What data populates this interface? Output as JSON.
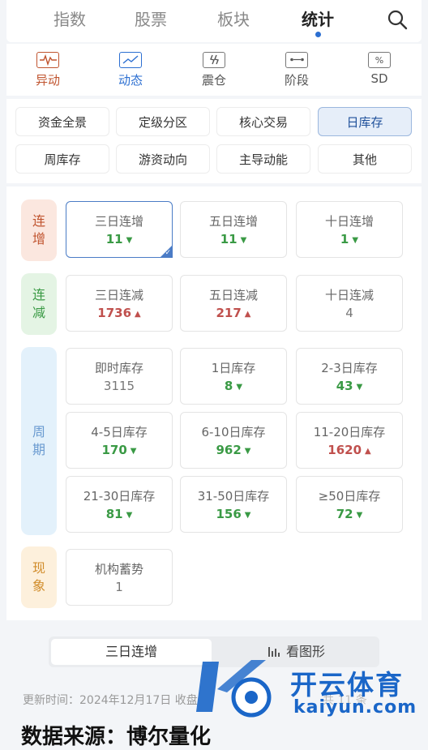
{
  "top_tabs": [
    "指数",
    "股票",
    "板块",
    "统计"
  ],
  "sub_nav": [
    {
      "label": "异动",
      "icon": "pulse-icon"
    },
    {
      "label": "动态",
      "icon": "trend-icon"
    },
    {
      "label": "震仓",
      "icon": "shake-icon"
    },
    {
      "label": "阶段",
      "icon": "stage-icon"
    },
    {
      "label": "SD",
      "icon": "percent-icon"
    }
  ],
  "categories": [
    "资金全景",
    "定级分区",
    "核心交易",
    "日库存",
    "周库存",
    "游资动向",
    "主导动能",
    "其他"
  ],
  "groups": {
    "lianzeng": {
      "label_1": "连",
      "label_2": "增"
    },
    "lianjian": {
      "label_1": "连",
      "label_2": "减"
    },
    "zhouqi": {
      "label_1": "周",
      "label_2": "期"
    },
    "xianxiang": {
      "label_1": "现",
      "label_2": "象"
    }
  },
  "cells": [
    {
      "title": "三日连增",
      "value": "11"
    },
    {
      "title": "五日连增",
      "value": "11"
    },
    {
      "title": "十日连增",
      "value": "1"
    },
    {
      "title": "三日连减",
      "value": "1736"
    },
    {
      "title": "五日连减",
      "value": "217"
    },
    {
      "title": "十日连减",
      "value": "4"
    },
    {
      "title": "即时库存",
      "value": "3115"
    },
    {
      "title": "1日库存",
      "value": "8"
    },
    {
      "title": "2-3日库存",
      "value": "43"
    },
    {
      "title": "4-5日库存",
      "value": "170"
    },
    {
      "title": "6-10日库存",
      "value": "962"
    },
    {
      "title": "11-20日库存",
      "value": "1620"
    },
    {
      "title": "21-30日库存",
      "value": "81"
    },
    {
      "title": "31-50日库存",
      "value": "156"
    },
    {
      "title": "≥50日库存",
      "value": "72"
    },
    {
      "title": "机构蓄势",
      "value": "1"
    }
  ],
  "bottom_tabs": {
    "selected": "三日连增",
    "graph": "看图形"
  },
  "footer": {
    "update": "更新时间：2024年12月17日 收盘",
    "total": "共 11 条",
    "source": "数据来源：博尔量化"
  },
  "watermark": {
    "brand": "开云体育",
    "domain": "kaiyun.com"
  },
  "colors": {
    "accent": "#2c6fd1",
    "up": "#c0504d",
    "down": "#3a9a45"
  }
}
